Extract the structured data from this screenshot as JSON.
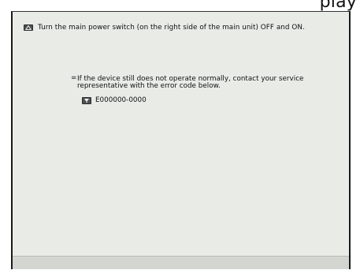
{
  "header": {
    "title": "play"
  },
  "message": {
    "main": "Turn the main power switch (on the right side of the main unit) OFF and ON.",
    "note": "If the device still does not operate normally, contact your service representative with the error code below.",
    "bullet": "=",
    "error_code": "E000000-0000"
  },
  "icons": {
    "warning": "warning-icon",
    "service": "service-icon"
  }
}
